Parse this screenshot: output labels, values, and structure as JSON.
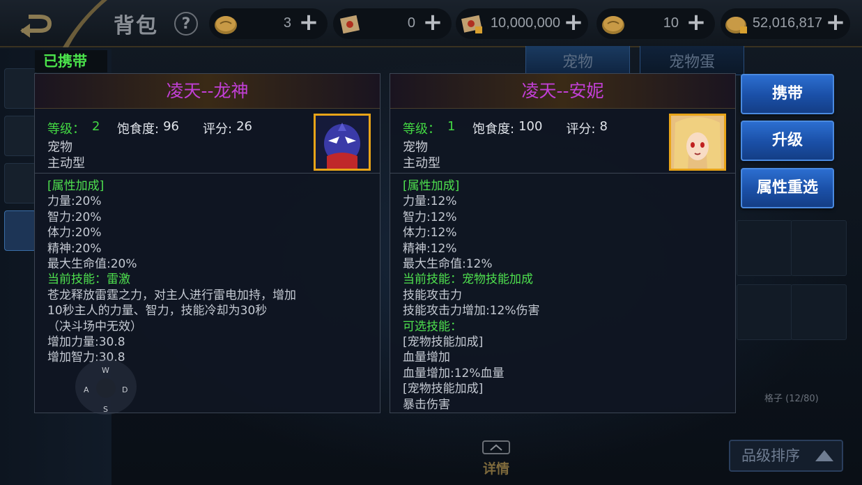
{
  "header": {
    "title": "背包",
    "help": "?",
    "resources": [
      {
        "icon": "coin-icon",
        "value": "3"
      },
      {
        "icon": "scroll-icon",
        "value": "0"
      },
      {
        "icon": "locked-scroll-icon",
        "value": "10,000,000"
      },
      {
        "icon": "coin-icon",
        "value": "10"
      },
      {
        "icon": "locked-coin-icon",
        "value": "52,016,817"
      }
    ],
    "plus": "+"
  },
  "tabs": [
    {
      "label": "宠物"
    },
    {
      "label": "宠物蛋"
    }
  ],
  "carried_label": "已携带",
  "cards": [
    {
      "name": "凌天--龙神",
      "level_label": "等级：",
      "level": "2",
      "satiety_label": "饱食度:",
      "satiety": "96",
      "score_label": "评分:",
      "score": "26",
      "type": "宠物",
      "mode": "主动型",
      "portrait": "dragon-ninja-portrait",
      "body": [
        {
          "text": "[属性加成]",
          "green": true
        },
        {
          "text": "力量:20%",
          "green": false
        },
        {
          "text": "智力:20%",
          "green": false
        },
        {
          "text": "体力:20%",
          "green": false
        },
        {
          "text": "精神:20%",
          "green": false
        },
        {
          "text": "最大生命值:20%",
          "green": false
        },
        {
          "text": "当前技能：雷激",
          "green": true
        },
        {
          "text": "苍龙释放雷霆之力，对主人进行雷电加持，增加",
          "green": false
        },
        {
          "text": "10秒主人的力量、智力，技能冷却为30秒",
          "green": false
        },
        {
          "text": "（决斗场中无效）",
          "green": false
        },
        {
          "text": "增加力量:30.8",
          "green": false
        },
        {
          "text": "增加智力:30.8",
          "green": false
        }
      ]
    },
    {
      "name": "凌天--安妮",
      "level_label": "等级：",
      "level": "1",
      "satiety_label": "饱食度:",
      "satiety": "100",
      "score_label": "评分:",
      "score": "8",
      "type": "宠物",
      "mode": "主动型",
      "portrait": "blonde-girl-portrait",
      "body": [
        {
          "text": "[属性加成]",
          "green": true
        },
        {
          "text": "力量:12%",
          "green": false
        },
        {
          "text": "智力:12%",
          "green": false
        },
        {
          "text": "体力:12%",
          "green": false
        },
        {
          "text": "精神:12%",
          "green": false
        },
        {
          "text": "最大生命值:12%",
          "green": false
        },
        {
          "text": "当前技能：宠物技能加成",
          "green": true
        },
        {
          "text": "技能攻击力",
          "green": false
        },
        {
          "text": "技能攻击力增加:12%伤害",
          "green": false
        },
        {
          "text": "可选技能：",
          "green": true
        },
        {
          "text": "[宠物技能加成]",
          "green": false
        },
        {
          "text": "血量增加",
          "green": false
        },
        {
          "text": "血量增加:12%血量",
          "green": false
        },
        {
          "text": "[宠物技能加成]",
          "green": false
        },
        {
          "text": "暴击伤害",
          "green": false
        }
      ]
    }
  ],
  "actions": {
    "carry": "携带",
    "upgrade": "升级",
    "reroll": "属性重选"
  },
  "grid_count": "格子 (12/80)",
  "sort_label": "品级排序",
  "detail_label": "详情",
  "wasd": {
    "w": "W",
    "a": "A",
    "s": "S",
    "d": "D"
  },
  "colors": {
    "pet_name": "#c23fd6",
    "green_text": "#4ee04e",
    "portrait_border": "#e8a418",
    "action_button": "#1a4fa6"
  }
}
